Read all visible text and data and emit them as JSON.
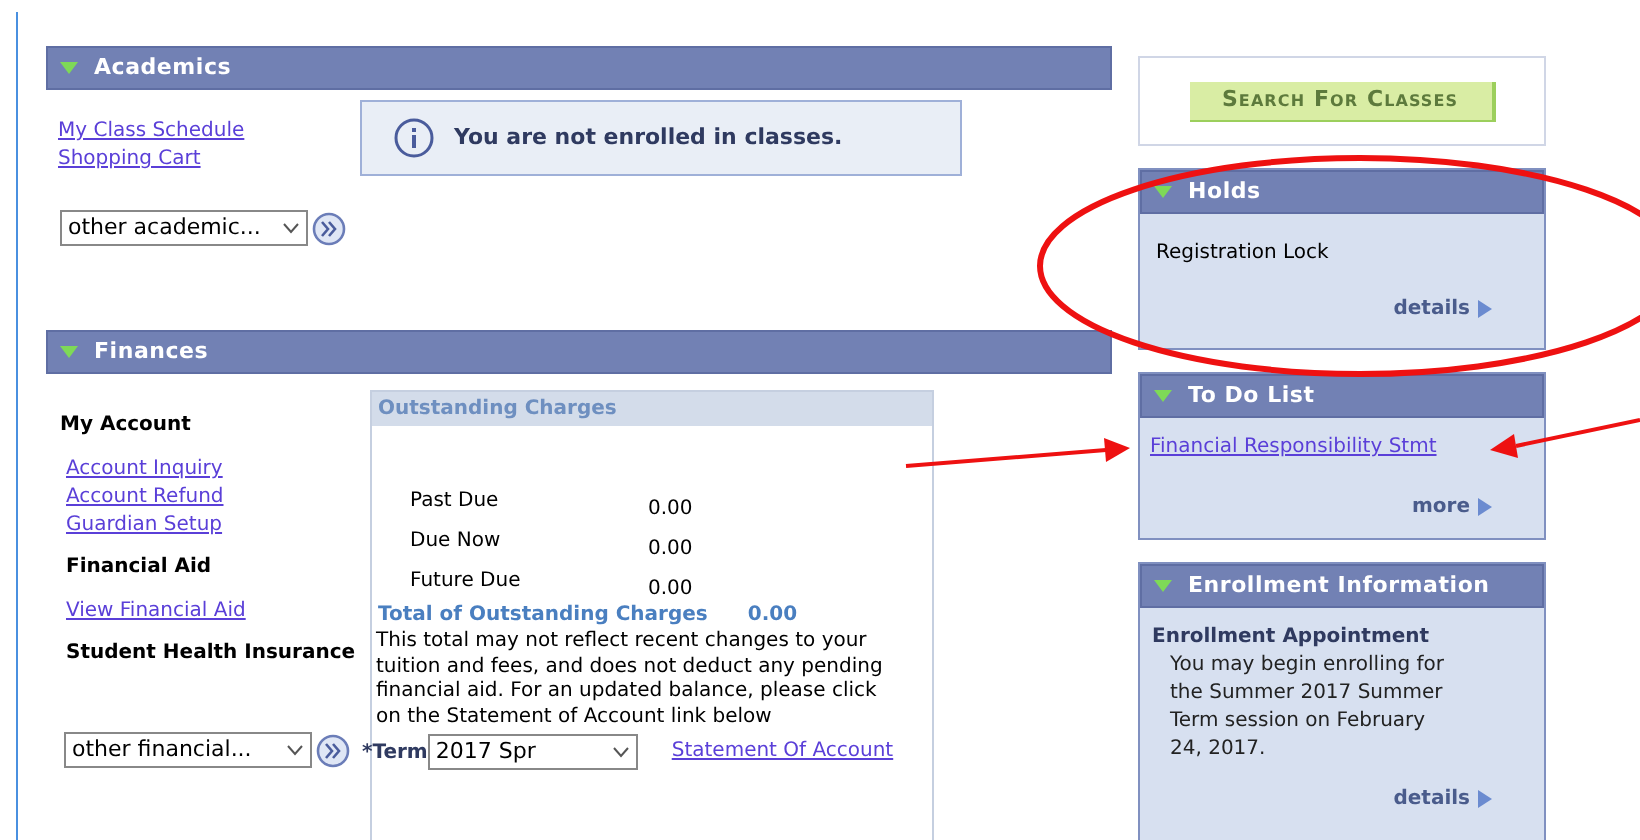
{
  "academics": {
    "title": "Academics",
    "expanded": true,
    "links": [
      "My Class Schedule",
      "Shopping Cart"
    ],
    "message": "You are not enrolled in classes.",
    "menu": {
      "value": "other academic..."
    }
  },
  "finances": {
    "title": "Finances",
    "expanded": true,
    "groups": [
      {
        "heading": "My Account",
        "links": [
          "Account Inquiry",
          "Account Refund",
          "Guardian Setup"
        ]
      },
      {
        "heading": "Financial Aid",
        "links": [
          "View Financial Aid"
        ]
      },
      {
        "heading": "Student Health Insurance"
      }
    ],
    "menu": {
      "value": "other financial..."
    },
    "charges": {
      "title": "Outstanding Charges",
      "rows": [
        {
          "label": "Past Due",
          "amount": "0.00"
        },
        {
          "label": "Due Now",
          "amount": "0.00"
        },
        {
          "label": "Future Due",
          "amount": "0.00"
        }
      ],
      "total_label": "Total of Outstanding Charges",
      "total": "0.00",
      "note": "This total may not reflect recent changes to your tuition and fees, and does not deduct any pending financial aid. For an updated balance, please click on the Statement of Account link below",
      "term_label": "*Term",
      "term": "2017 Spr",
      "link": "Statement Of Account"
    }
  },
  "search_button": "Search For Classes",
  "holds": {
    "title": "Holds",
    "expanded": true,
    "items": [
      "Registration Lock"
    ],
    "link": "details"
  },
  "todo": {
    "title": "To Do List",
    "expanded": true,
    "items": [
      "Financial Responsibility Stmt"
    ],
    "link": "more"
  },
  "enrollment": {
    "title": "Enrollment Information",
    "expanded": true,
    "heading": "Enrollment Appointment",
    "text": "You may begin enrolling for the Summer 2017 Summer Term session on February 24, 2017.",
    "link": "details"
  },
  "markup": [
    {
      "kind": "ellipse"
    },
    {
      "kind": "arrow"
    },
    {
      "kind": "arrow"
    }
  ]
}
